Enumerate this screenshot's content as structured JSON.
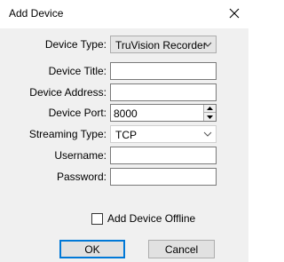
{
  "window": {
    "title": "Add Device",
    "close_icon": "close-icon"
  },
  "form": {
    "device_type": {
      "label": "Device Type:",
      "value": "TruVision Recorder"
    },
    "device_title": {
      "label": "Device Title:",
      "value": ""
    },
    "device_address": {
      "label": "Device Address:",
      "value": ""
    },
    "device_port": {
      "label": "Device Port:",
      "value": "8000"
    },
    "streaming_type": {
      "label": "Streaming Type:",
      "value": "TCP"
    },
    "username": {
      "label": "Username:",
      "value": ""
    },
    "password": {
      "label": "Password:",
      "value": ""
    }
  },
  "offline": {
    "label": "Add Device Offline",
    "checked": false
  },
  "buttons": {
    "ok": "OK",
    "cancel": "Cancel"
  }
}
